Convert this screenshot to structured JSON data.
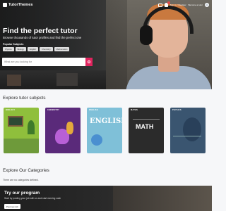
{
  "nav": {
    "brand": "TutorThemes",
    "links": [
      "Sign in / Register",
      "Become a tutor"
    ]
  },
  "hero": {
    "title": "Find the perfect tutor",
    "subtitle": "Browse thousands of tutor profiles and find the perfect one",
    "popular_label": "Popular Subjects",
    "chips": [
      "Physics",
      "Biology",
      "English",
      "Chemistry",
      "Mathematics"
    ],
    "search_placeholder": "What are you looking for"
  },
  "subjects": {
    "title": "Explore tutor subjects",
    "cards": [
      {
        "label": "BIOLOGY"
      },
      {
        "label": "CHEMISTRY"
      },
      {
        "label": "ENGLISH",
        "art_text": "ENGLISH"
      },
      {
        "label": "MATHS",
        "art_text": "MATH"
      },
      {
        "label": "PHYSICS"
      }
    ]
  },
  "categories": {
    "title": "Explore Our Categories",
    "empty_text": "There are no categories defined."
  },
  "banner": {
    "title": "Try our program",
    "subtitle": "Start by posting your job with us and start earning cash",
    "button": "Post new Job"
  },
  "colors": {
    "accent": "#e0245e",
    "badge": "#e24a4a"
  }
}
